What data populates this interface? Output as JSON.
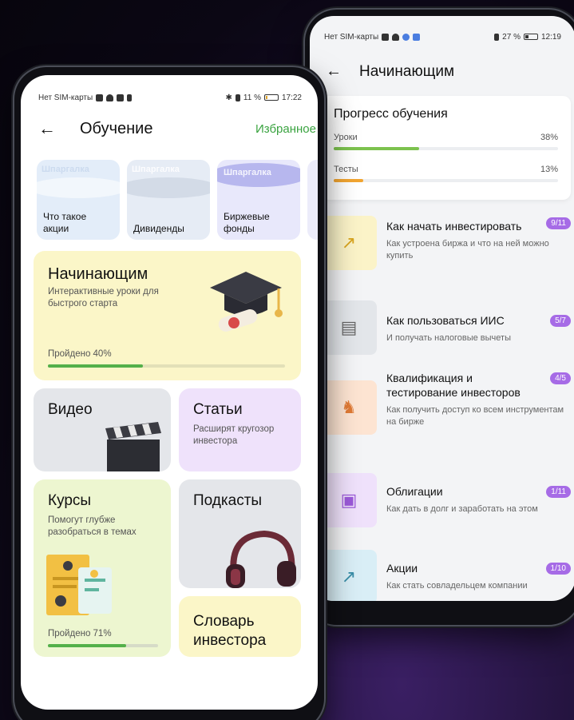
{
  "colors": {
    "accent_green": "#3aa340",
    "lessons_bar": "#7cc24e",
    "tests_bar": "#f2a531",
    "badge_purple": "#a66be6",
    "progress_fill": "#54b04a"
  },
  "back_screen": {
    "status": {
      "sim": "Нет SIM-карты",
      "battery": "27 %",
      "time": "12:19"
    },
    "header": {
      "back_icon": "arrow-left-icon",
      "title": "Начинающим"
    },
    "progress": {
      "title": "Прогресс обучения",
      "rows": [
        {
          "label": "Уроки",
          "value": "38%",
          "fraction": 0.38
        },
        {
          "label": "Тесты",
          "value": "13%",
          "fraction": 0.13
        }
      ]
    },
    "lessons": [
      {
        "title": "Как начать инвестировать",
        "desc": "Как устроена биржа и что на ней можно купить",
        "badge": "9/11",
        "icon": "cursor-click-icon",
        "icon_bg": "#fbf3c8",
        "icon_color": "#d9a520"
      },
      {
        "title": "Как пользоваться ИИС",
        "desc": "И получать налоговые вычеты",
        "badge": "5/7",
        "icon": "wallet-chart-icon",
        "icon_bg": "#e3e6ea",
        "icon_color": "#666"
      },
      {
        "title": "Квалификация и тестирование инвесторов",
        "desc": "Как получить доступ ко всем инструментам на бирже",
        "badge": "4/5",
        "icon": "chess-knight-icon",
        "icon_bg": "#fde4d2",
        "icon_color": "#e07a35"
      },
      {
        "title": "Облигации",
        "desc": "Как дать в долг и заработать на этом",
        "badge": "1/11",
        "icon": "bond-document-icon",
        "icon_bg": "#efe1fb",
        "icon_color": "#9b59d9"
      },
      {
        "title": "Акции",
        "desc": "Как стать совладельцем компании",
        "badge": "1/10",
        "icon": "trend-up-icon",
        "icon_bg": "#d9eef6",
        "icon_color": "#3a8ea8"
      }
    ]
  },
  "front_screen": {
    "status": {
      "sim": "Нет SIM-карты",
      "battery": "11 %",
      "time": "17:22"
    },
    "header": {
      "back_icon": "arrow-left-icon",
      "title": "Обучение",
      "favorites": "Избранное"
    },
    "cheatsheets": [
      {
        "tag": "Шпаргалка",
        "title": "Что такое акции",
        "bg": "#e3edf9"
      },
      {
        "tag": "Шпаргалка",
        "title": "Дивиденды",
        "bg": "#e6ecf5"
      },
      {
        "tag": "Шпаргалка",
        "title": "Биржевые фонды",
        "bg": "#e8e8fb"
      }
    ],
    "beginners": {
      "title": "Начинающим",
      "desc": "Интерактивные уроки для быстрого старта",
      "passed": "Пройдено 40%",
      "fraction": 0.4
    },
    "video": {
      "title": "Видео"
    },
    "articles": {
      "title": "Статьи",
      "desc": "Расширят кругозор инвестора"
    },
    "courses": {
      "title": "Курсы",
      "desc": "Помогут глубже разобраться в темах",
      "passed": "Пройдено 71%",
      "fraction": 0.71
    },
    "podcasts": {
      "title": "Подкасты"
    },
    "glossary": {
      "title": "Словарь инвестора"
    }
  }
}
